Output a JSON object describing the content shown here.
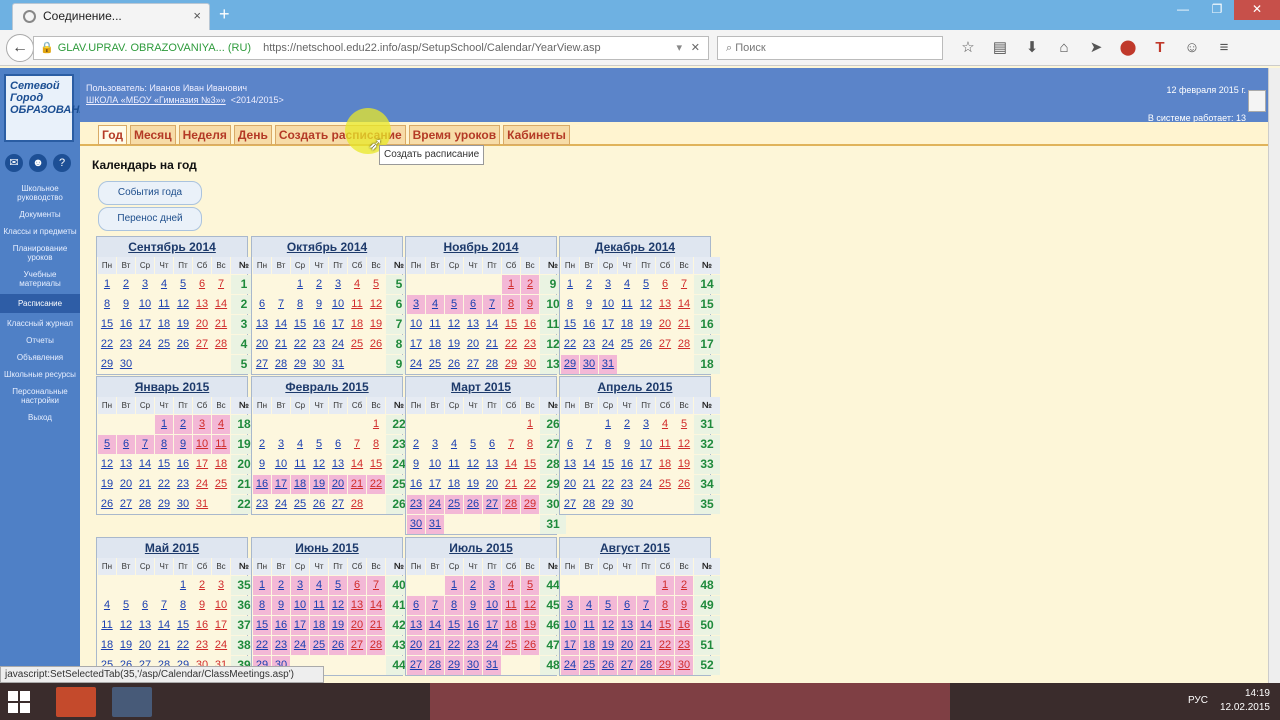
{
  "browser": {
    "tab_title": "Соединение...",
    "new_tab_label": "+",
    "minimize": "—",
    "maximize": "❐",
    "close": "✕",
    "url_org": "GLAV.UPRAV. OBRAZOVANIYA... (RU)",
    "url": "https://netschool.edu22.info/asp/SetupSchool/Calendar/YearView.asp",
    "search_placeholder": "Поиск"
  },
  "sidebar": {
    "logo_text": "Сетевой Город ОБРАЗОВАНИЕ",
    "items": [
      {
        "label": "Школьное руководство"
      },
      {
        "label": "Документы"
      },
      {
        "label": "Классы и предметы"
      },
      {
        "label": "Планирование уроков"
      },
      {
        "label": "Учебные материалы"
      },
      {
        "label": "Расписание"
      },
      {
        "label": "Классный журнал"
      },
      {
        "label": "Отчеты"
      },
      {
        "label": "Объявления"
      },
      {
        "label": "Школьные ресурсы"
      },
      {
        "label": "Персональные настройки"
      },
      {
        "label": "Выход"
      }
    ]
  },
  "header": {
    "user_line": "Пользователь: Иванов Иван Иванович",
    "school": "ШКОЛА «МБОУ «Гимназия №3»»",
    "year": "<2014/2015>",
    "date": "12 февраля 2015 г.",
    "online": "В системе работает: 13"
  },
  "tabs": [
    "Год",
    "Месяц",
    "Неделя",
    "День",
    "Создать расписание",
    "Время уроков",
    "Кабинеты"
  ],
  "tooltip": "Создать расписание",
  "page": {
    "title": "Календарь на год",
    "btn_events": "События года",
    "btn_transfer": "Перенос дней"
  },
  "weekday_headers": [
    "Пн",
    "Вт",
    "Ср",
    "Чт",
    "Пт",
    "Сб",
    "Вс",
    "№"
  ],
  "calendar": [
    {
      "name": "Сентябрь 2014",
      "rows": [
        {
          "days": [
            "1",
            "2",
            "3",
            "4",
            "5",
            "6",
            "7"
          ],
          "week": "1"
        },
        {
          "days": [
            "8",
            "9",
            "10",
            "11",
            "12",
            "13",
            "14"
          ],
          "week": "2"
        },
        {
          "days": [
            "15",
            "16",
            "17",
            "18",
            "19",
            "20",
            "21"
          ],
          "week": "3"
        },
        {
          "days": [
            "22",
            "23",
            "24",
            "25",
            "26",
            "27",
            "28"
          ],
          "week": "4"
        },
        {
          "days": [
            "29",
            "30",
            "",
            "",
            "",
            "",
            ""
          ],
          "week": "5"
        }
      ]
    },
    {
      "name": "Октябрь 2014",
      "rows": [
        {
          "days": [
            "",
            "",
            "1",
            "2",
            "3",
            "4",
            "5"
          ],
          "week": "5"
        },
        {
          "days": [
            "6",
            "7",
            "8",
            "9",
            "10",
            "11",
            "12"
          ],
          "week": "6"
        },
        {
          "days": [
            "13",
            "14",
            "15",
            "16",
            "17",
            "18",
            "19"
          ],
          "week": "7"
        },
        {
          "days": [
            "20",
            "21",
            "22",
            "23",
            "24",
            "25",
            "26"
          ],
          "week": "8"
        },
        {
          "days": [
            "27",
            "28",
            "29",
            "30",
            "31",
            "",
            ""
          ],
          "week": "9"
        }
      ]
    },
    {
      "name": "Ноябрь 2014",
      "rows": [
        {
          "days": [
            "",
            "",
            "",
            "",
            "",
            "1",
            "2"
          ],
          "week": "9"
        },
        {
          "days": [
            "3",
            "4",
            "5",
            "6",
            "7",
            "8",
            "9"
          ],
          "week": "10"
        },
        {
          "days": [
            "10",
            "11",
            "12",
            "13",
            "14",
            "15",
            "16"
          ],
          "week": "11"
        },
        {
          "days": [
            "17",
            "18",
            "19",
            "20",
            "21",
            "22",
            "23"
          ],
          "week": "12"
        },
        {
          "days": [
            "24",
            "25",
            "26",
            "27",
            "28",
            "29",
            "30"
          ],
          "week": "13"
        }
      ]
    },
    {
      "name": "Декабрь 2014",
      "rows": [
        {
          "days": [
            "1",
            "2",
            "3",
            "4",
            "5",
            "6",
            "7"
          ],
          "week": "14"
        },
        {
          "days": [
            "8",
            "9",
            "10",
            "11",
            "12",
            "13",
            "14"
          ],
          "week": "15"
        },
        {
          "days": [
            "15",
            "16",
            "17",
            "18",
            "19",
            "20",
            "21"
          ],
          "week": "16"
        },
        {
          "days": [
            "22",
            "23",
            "24",
            "25",
            "26",
            "27",
            "28"
          ],
          "week": "17"
        },
        {
          "days": [
            "29",
            "30",
            "31",
            "",
            "",
            "",
            ""
          ],
          "week": "18"
        }
      ]
    },
    {
      "name": "Январь 2015",
      "rows": [
        {
          "days": [
            "",
            "",
            "",
            "1",
            "2",
            "3",
            "4"
          ],
          "week": "18"
        },
        {
          "days": [
            "5",
            "6",
            "7",
            "8",
            "9",
            "10",
            "11"
          ],
          "week": "19"
        },
        {
          "days": [
            "12",
            "13",
            "14",
            "15",
            "16",
            "17",
            "18"
          ],
          "week": "20"
        },
        {
          "days": [
            "19",
            "20",
            "21",
            "22",
            "23",
            "24",
            "25"
          ],
          "week": "21"
        },
        {
          "days": [
            "26",
            "27",
            "28",
            "29",
            "30",
            "31",
            ""
          ],
          "week": "22"
        }
      ]
    },
    {
      "name": "Февраль 2015",
      "rows": [
        {
          "days": [
            "",
            "",
            "",
            "",
            "",
            "",
            "1"
          ],
          "week": "22"
        },
        {
          "days": [
            "2",
            "3",
            "4",
            "5",
            "6",
            "7",
            "8"
          ],
          "week": "23"
        },
        {
          "days": [
            "9",
            "10",
            "11",
            "12",
            "13",
            "14",
            "15"
          ],
          "week": "24"
        },
        {
          "days": [
            "16",
            "17",
            "18",
            "19",
            "20",
            "21",
            "22"
          ],
          "week": "25"
        },
        {
          "days": [
            "23",
            "24",
            "25",
            "26",
            "27",
            "28",
            ""
          ],
          "week": "26"
        }
      ]
    },
    {
      "name": "Март 2015",
      "rows": [
        {
          "days": [
            "",
            "",
            "",
            "",
            "",
            "",
            "1"
          ],
          "week": "26"
        },
        {
          "days": [
            "2",
            "3",
            "4",
            "5",
            "6",
            "7",
            "8"
          ],
          "week": "27"
        },
        {
          "days": [
            "9",
            "10",
            "11",
            "12",
            "13",
            "14",
            "15"
          ],
          "week": "28"
        },
        {
          "days": [
            "16",
            "17",
            "18",
            "19",
            "20",
            "21",
            "22"
          ],
          "week": "29"
        },
        {
          "days": [
            "23",
            "24",
            "25",
            "26",
            "27",
            "28",
            "29"
          ],
          "week": "30"
        },
        {
          "days": [
            "30",
            "31",
            "",
            "",
            "",
            "",
            ""
          ],
          "week": "31"
        }
      ]
    },
    {
      "name": "Апрель 2015",
      "rows": [
        {
          "days": [
            "",
            "",
            "1",
            "2",
            "3",
            "4",
            "5"
          ],
          "week": "31"
        },
        {
          "days": [
            "6",
            "7",
            "8",
            "9",
            "10",
            "11",
            "12"
          ],
          "week": "32"
        },
        {
          "days": [
            "13",
            "14",
            "15",
            "16",
            "17",
            "18",
            "19"
          ],
          "week": "33"
        },
        {
          "days": [
            "20",
            "21",
            "22",
            "23",
            "24",
            "25",
            "26"
          ],
          "week": "34"
        },
        {
          "days": [
            "27",
            "28",
            "29",
            "30",
            "",
            "",
            ""
          ],
          "week": "35"
        }
      ]
    },
    {
      "name": "Май 2015",
      "rows": [
        {
          "days": [
            "",
            "",
            "",
            "",
            "1",
            "2",
            "3"
          ],
          "week": "35"
        },
        {
          "days": [
            "4",
            "5",
            "6",
            "7",
            "8",
            "9",
            "10"
          ],
          "week": "36"
        },
        {
          "days": [
            "11",
            "12",
            "13",
            "14",
            "15",
            "16",
            "17"
          ],
          "week": "37"
        },
        {
          "days": [
            "18",
            "19",
            "20",
            "21",
            "22",
            "23",
            "24"
          ],
          "week": "38"
        },
        {
          "days": [
            "25",
            "26",
            "27",
            "28",
            "29",
            "30",
            "31"
          ],
          "week": "39"
        }
      ]
    },
    {
      "name": "Июнь 2015",
      "rows": [
        {
          "days": [
            "1",
            "2",
            "3",
            "4",
            "5",
            "6",
            "7"
          ],
          "week": "40"
        },
        {
          "days": [
            "8",
            "9",
            "10",
            "11",
            "12",
            "13",
            "14"
          ],
          "week": "41"
        },
        {
          "days": [
            "15",
            "16",
            "17",
            "18",
            "19",
            "20",
            "21"
          ],
          "week": "42"
        },
        {
          "days": [
            "22",
            "23",
            "24",
            "25",
            "26",
            "27",
            "28"
          ],
          "week": "43"
        },
        {
          "days": [
            "29",
            "30",
            "",
            "",
            "",
            "",
            ""
          ],
          "week": "44"
        }
      ]
    },
    {
      "name": "Июль 2015",
      "rows": [
        {
          "days": [
            "",
            "",
            "1",
            "2",
            "3",
            "4",
            "5"
          ],
          "week": "44"
        },
        {
          "days": [
            "6",
            "7",
            "8",
            "9",
            "10",
            "11",
            "12"
          ],
          "week": "45"
        },
        {
          "days": [
            "13",
            "14",
            "15",
            "16",
            "17",
            "18",
            "19"
          ],
          "week": "46"
        },
        {
          "days": [
            "20",
            "21",
            "22",
            "23",
            "24",
            "25",
            "26"
          ],
          "week": "47"
        },
        {
          "days": [
            "27",
            "28",
            "29",
            "30",
            "31",
            "",
            ""
          ],
          "week": "48"
        }
      ]
    },
    {
      "name": "Август 2015",
      "rows": [
        {
          "days": [
            "",
            "",
            "",
            "",
            "",
            "1",
            "2"
          ],
          "week": "48"
        },
        {
          "days": [
            "3",
            "4",
            "5",
            "6",
            "7",
            "8",
            "9"
          ],
          "week": "49"
        },
        {
          "days": [
            "10",
            "11",
            "12",
            "13",
            "14",
            "15",
            "16"
          ],
          "week": "50"
        },
        {
          "days": [
            "17",
            "18",
            "19",
            "20",
            "21",
            "22",
            "23"
          ],
          "week": "51"
        },
        {
          "days": [
            "24",
            "25",
            "26",
            "27",
            "28",
            "29",
            "30"
          ],
          "week": "52"
        }
      ]
    }
  ],
  "vacation_days": {
    "Ноябрь 2014": [
      "1",
      "2",
      "3",
      "4",
      "5",
      "6",
      "7",
      "8",
      "9"
    ],
    "Декабрь 2014": [
      "29",
      "30",
      "31"
    ],
    "Январь 2015": [
      "1",
      "2",
      "3",
      "4",
      "5",
      "6",
      "7",
      "8",
      "9",
      "10",
      "11"
    ],
    "Февраль 2015": [
      "16",
      "17",
      "18",
      "19",
      "20",
      "21",
      "22"
    ],
    "Март 2015": [
      "23",
      "24",
      "25",
      "26",
      "27",
      "28",
      "29",
      "30",
      "31"
    ],
    "Июнь 2015": [
      "1",
      "2",
      "3",
      "4",
      "5",
      "6",
      "7",
      "8",
      "9",
      "10",
      "11",
      "12",
      "13",
      "14",
      "15",
      "16",
      "17",
      "18",
      "19",
      "20",
      "21",
      "22",
      "23",
      "24",
      "25",
      "26",
      "27",
      "28",
      "29",
      "30"
    ],
    "Июль 2015": [
      "1",
      "2",
      "3",
      "4",
      "5",
      "6",
      "7",
      "8",
      "9",
      "10",
      "11",
      "12",
      "13",
      "14",
      "15",
      "16",
      "17",
      "18",
      "19",
      "20",
      "21",
      "22",
      "23",
      "24",
      "25",
      "26",
      "27",
      "28",
      "29",
      "30",
      "31"
    ],
    "Август 2015": [
      "1",
      "2",
      "3",
      "4",
      "5",
      "6",
      "7",
      "8",
      "9",
      "10",
      "11",
      "12",
      "13",
      "14",
      "15",
      "16",
      "17",
      "18",
      "19",
      "20",
      "21",
      "22",
      "23",
      "24",
      "25",
      "26",
      "27",
      "28",
      "29",
      "30"
    ]
  },
  "status": "javascript:SetSelectedTab(35,'/asp/Calendar/ClassMeetings.asp')",
  "taskbar": {
    "lang": "РУС",
    "time": "14:19",
    "date": "12.02.2015"
  },
  "colors": {
    "accent_header": "#5b84c9",
    "tab_text": "#b43a26",
    "vacation": "#f3b8d6",
    "holiday": "#d02b2b",
    "week_number": "#1f8a3c"
  }
}
